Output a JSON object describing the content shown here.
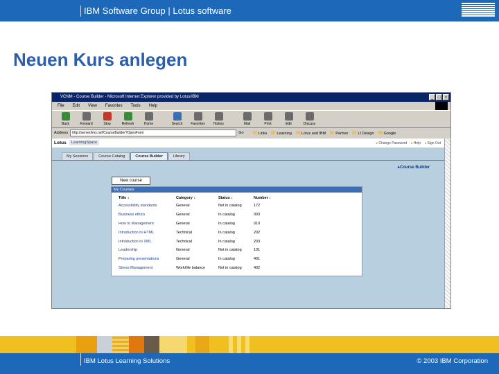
{
  "slide": {
    "header_text": "IBM Software Group  |  Lotus software",
    "logo_text": "IBM",
    "title": "Neuen Kurs anlegen",
    "footer_left": "IBM Lotus Learning Solutions",
    "footer_right": "© 2003 IBM Corporation"
  },
  "colors": {
    "brand_blue": "#1d68b8",
    "footer_yellow": "#f0c020",
    "title_blue": "#2b5fae"
  },
  "browser": {
    "window_title": "VCNM - Course Builder - Microsoft Internet Explorer provided by Lotus/IBM",
    "menu": [
      "File",
      "Edit",
      "View",
      "Favorites",
      "Tools",
      "Help"
    ],
    "toolbar": [
      "Back",
      "Forward",
      "Stop",
      "Refresh",
      "Home",
      "Search",
      "Favorites",
      "History",
      "Mail",
      "Print",
      "Edit",
      "Discuss"
    ],
    "address_label": "Address",
    "address_value": "http://server/lms.nsf/CourseBuilder?OpenForm",
    "go_label": "Go",
    "links": [
      "Links",
      "Learning",
      "Lotus and IBM",
      "Partner",
      "LI Design",
      "Google"
    ]
  },
  "app": {
    "brand": "Lotus",
    "product": "LearningSpace",
    "utilities": [
      "Change Password",
      "Help",
      "Sign Out"
    ],
    "tabs": [
      "My Sessions",
      "Course Catalog",
      "Course Builder",
      "Library"
    ],
    "breadcrumb": "▸Course Builder",
    "new_course_label": "New course",
    "list_title": "My Courses",
    "columns": [
      "Title ↕",
      "Category ↕",
      "Status ↕",
      "Number ↕"
    ],
    "rows": [
      [
        "Accessibility standards",
        "General",
        "Not in catalog",
        "172"
      ],
      [
        "Business ethics",
        "General",
        "In catalog",
        "003"
      ],
      [
        "How to Management",
        "General",
        "In catalog",
        "010"
      ],
      [
        "Introduction to HTML",
        "Technical",
        "In catalog",
        "202"
      ],
      [
        "Introduction to XML",
        "Technical",
        "In catalog",
        "203"
      ],
      [
        "Leadership",
        "General",
        "Not in catalog",
        "101"
      ],
      [
        "Preparing presentations",
        "General",
        "In catalog",
        "401"
      ],
      [
        "Stress Management",
        "Work/life balance",
        "Not in catalog",
        "402"
      ]
    ]
  }
}
